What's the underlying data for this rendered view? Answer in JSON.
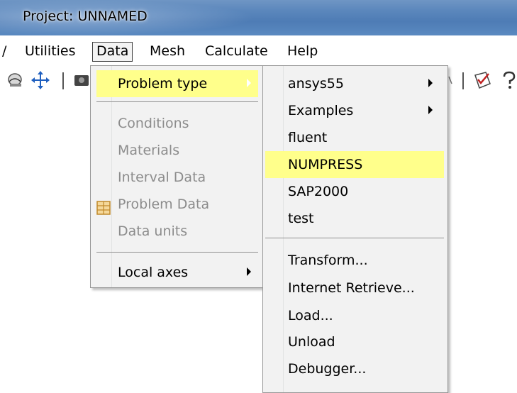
{
  "window": {
    "title": "Project: UNNAMED"
  },
  "menubar": {
    "partial_left": "/",
    "items": [
      "Utilities",
      "Data",
      "Mesh",
      "Calculate",
      "Help"
    ],
    "active": "Data"
  },
  "data_menu": {
    "items": [
      {
        "label": "Problem type",
        "enabled": true,
        "highlighted": true,
        "submenu": true
      },
      {
        "label": "Conditions",
        "enabled": false
      },
      {
        "label": "Materials",
        "enabled": false
      },
      {
        "label": "Interval Data",
        "enabled": false
      },
      {
        "label": "Problem Data",
        "enabled": false,
        "icon": "table-icon"
      },
      {
        "label": "Data units",
        "enabled": false
      },
      {
        "label": "Local axes",
        "enabled": true,
        "submenu": true
      }
    ]
  },
  "problem_type_menu": {
    "items": [
      {
        "label": "ansys55",
        "submenu": true
      },
      {
        "label": "Examples",
        "submenu": true
      },
      {
        "label": "fluent"
      },
      {
        "label": "NUMPRESS",
        "highlighted": true
      },
      {
        "label": "SAP2000"
      },
      {
        "label": "test"
      },
      {
        "label": "Transform..."
      },
      {
        "label": "Internet Retrieve..."
      },
      {
        "label": "Load..."
      },
      {
        "label": "Unload"
      },
      {
        "label": "Debugger..."
      }
    ]
  },
  "colors": {
    "highlight": "#ffff8b",
    "menu_background": "#f2f2f2",
    "disabled_text": "#8c8c8c",
    "titlebar": "#5b87bc"
  },
  "icons": [
    "move-arrows-icon",
    "table-icon",
    "checklist-icon",
    "help-icon",
    "chevron-right-icon"
  ]
}
